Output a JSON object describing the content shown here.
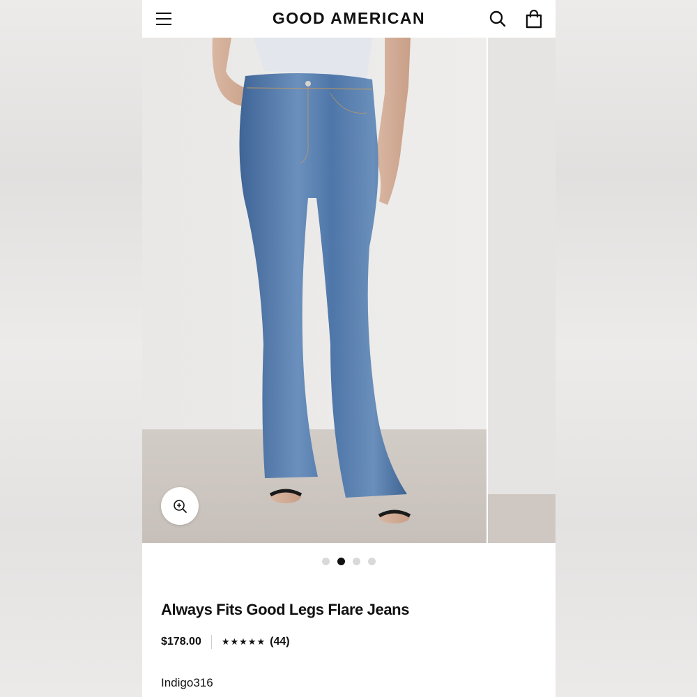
{
  "header": {
    "brand": "GOOD AMERICAN",
    "menu_icon": "hamburger-menu-icon",
    "search_icon": "search-icon",
    "bag_icon": "shopping-bag-icon"
  },
  "gallery": {
    "active_index": 1,
    "slide_count": 4,
    "zoom_icon": "zoom-in-icon"
  },
  "product": {
    "title": "Always Fits Good Legs Flare Jeans",
    "price": "$178.00",
    "rating_stars": "★★★★★",
    "review_count": "(44)",
    "color": "Indigo316"
  },
  "colors": {
    "denim": "#5479a8",
    "text": "#111111",
    "dot_inactive": "#d9d9d9"
  }
}
